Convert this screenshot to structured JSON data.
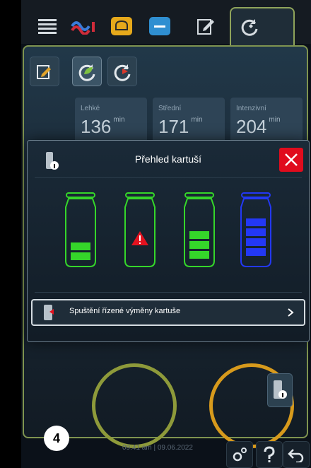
{
  "topbar": {
    "tabs": [
      {
        "icon": "menu-list-icon"
      },
      {
        "icon": "steam-heat-icon"
      },
      {
        "icon": "bread-icon"
      },
      {
        "icon": "tray-icon"
      },
      {
        "icon": "edit-icon"
      },
      {
        "icon": "care-cycle-icon",
        "active": true
      }
    ]
  },
  "modes": [
    {
      "icon": "edit-mode-icon"
    },
    {
      "icon": "care-leaf-icon",
      "active": true
    },
    {
      "icon": "care-forward-icon"
    }
  ],
  "cards": [
    {
      "label": "Lehké",
      "value": "136",
      "unit": "min"
    },
    {
      "label": "Střední",
      "value": "171",
      "unit": "min"
    },
    {
      "label": "Intenzivní",
      "value": "204",
      "unit": "min"
    }
  ],
  "dialog": {
    "title": "Přehled kartuší",
    "cartridges": [
      {
        "color": "#35d62a",
        "level": 0.45,
        "status": "ok"
      },
      {
        "color": "#35d62a",
        "level": 0,
        "status": "warning"
      },
      {
        "color": "#35d62a",
        "level": 0.75,
        "status": "ok"
      },
      {
        "color": "#2338f5",
        "level": 1.0,
        "status": "ok"
      }
    ],
    "action_label": "Spuštění řízené výměny kartuše"
  },
  "status": {
    "badge": "4",
    "clock": "09:41 am | 09.06.2022"
  },
  "colors": {
    "accent_green": "#8fa35a",
    "close_red": "#e00c1d"
  }
}
